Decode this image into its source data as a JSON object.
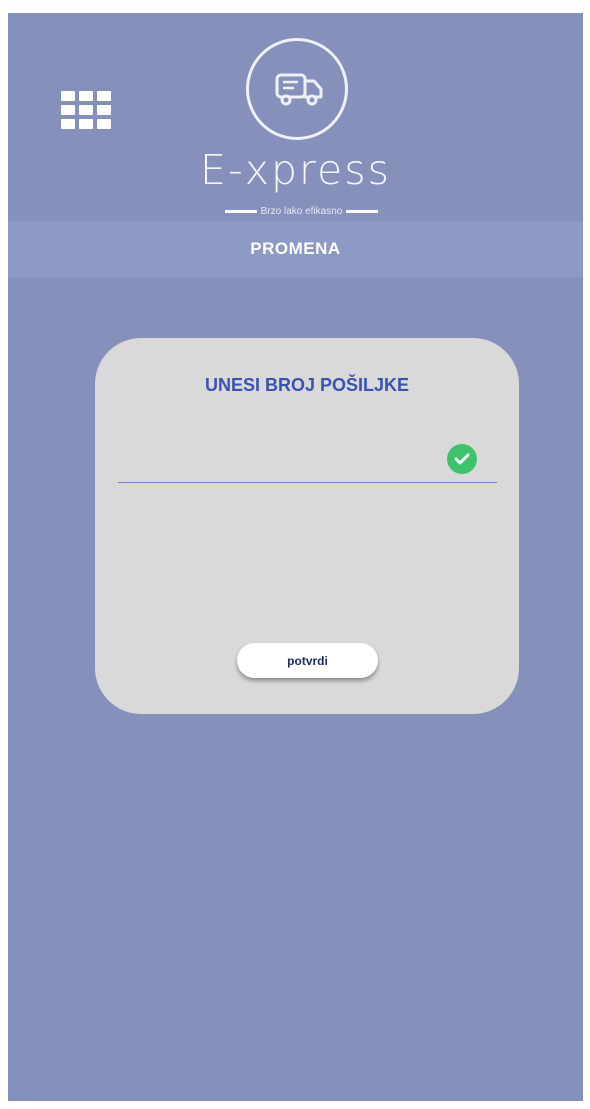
{
  "app": {
    "brand": "E-xpress",
    "tagline": "Brzo lako efikasno",
    "logo_icon": "delivery-truck-icon",
    "menu_icon": "grid-menu-icon"
  },
  "header": {
    "title": "PROMENA"
  },
  "card": {
    "title": "UNESI BROJ POŠILJKE",
    "input": {
      "value": "",
      "placeholder": "",
      "status_icon": "check-circle-icon"
    },
    "confirm_label": "potvrdi"
  },
  "colors": {
    "background": "#8590bb",
    "header_bar": "#8e9ac6",
    "card": "#d9d9d9",
    "title_accent": "#3a52b0",
    "success": "#3cc36b"
  }
}
